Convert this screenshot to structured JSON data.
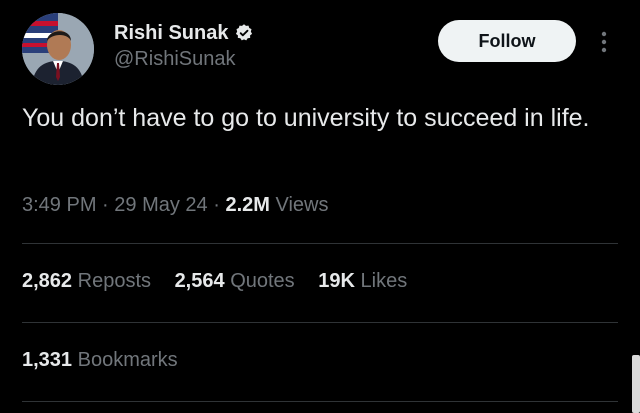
{
  "author": {
    "display_name": "Rishi Sunak",
    "handle": "@RishiSunak",
    "verified": true,
    "avatar_icon": "profile-photo"
  },
  "actions": {
    "follow_label": "Follow",
    "more_icon": "vertical-ellipsis-icon"
  },
  "tweet": {
    "text": "You don’t have to go to university to succeed in life."
  },
  "meta": {
    "time": "3:49 PM",
    "separator": "·",
    "date": "29 May 24",
    "views_count": "2.2M",
    "views_label": "Views"
  },
  "stats": {
    "reposts_count": "2,862",
    "reposts_label": "Reposts",
    "quotes_count": "2,564",
    "quotes_label": "Quotes",
    "likes_count": "19K",
    "likes_label": "Likes",
    "bookmarks_count": "1,331",
    "bookmarks_label": "Bookmarks"
  },
  "colors": {
    "background": "#000000",
    "text_primary": "#e7e9ea",
    "text_secondary": "#71767b",
    "verified_blue": "#1d9bf0",
    "divider": "#2f3336",
    "follow_bg": "#eff3f4"
  }
}
